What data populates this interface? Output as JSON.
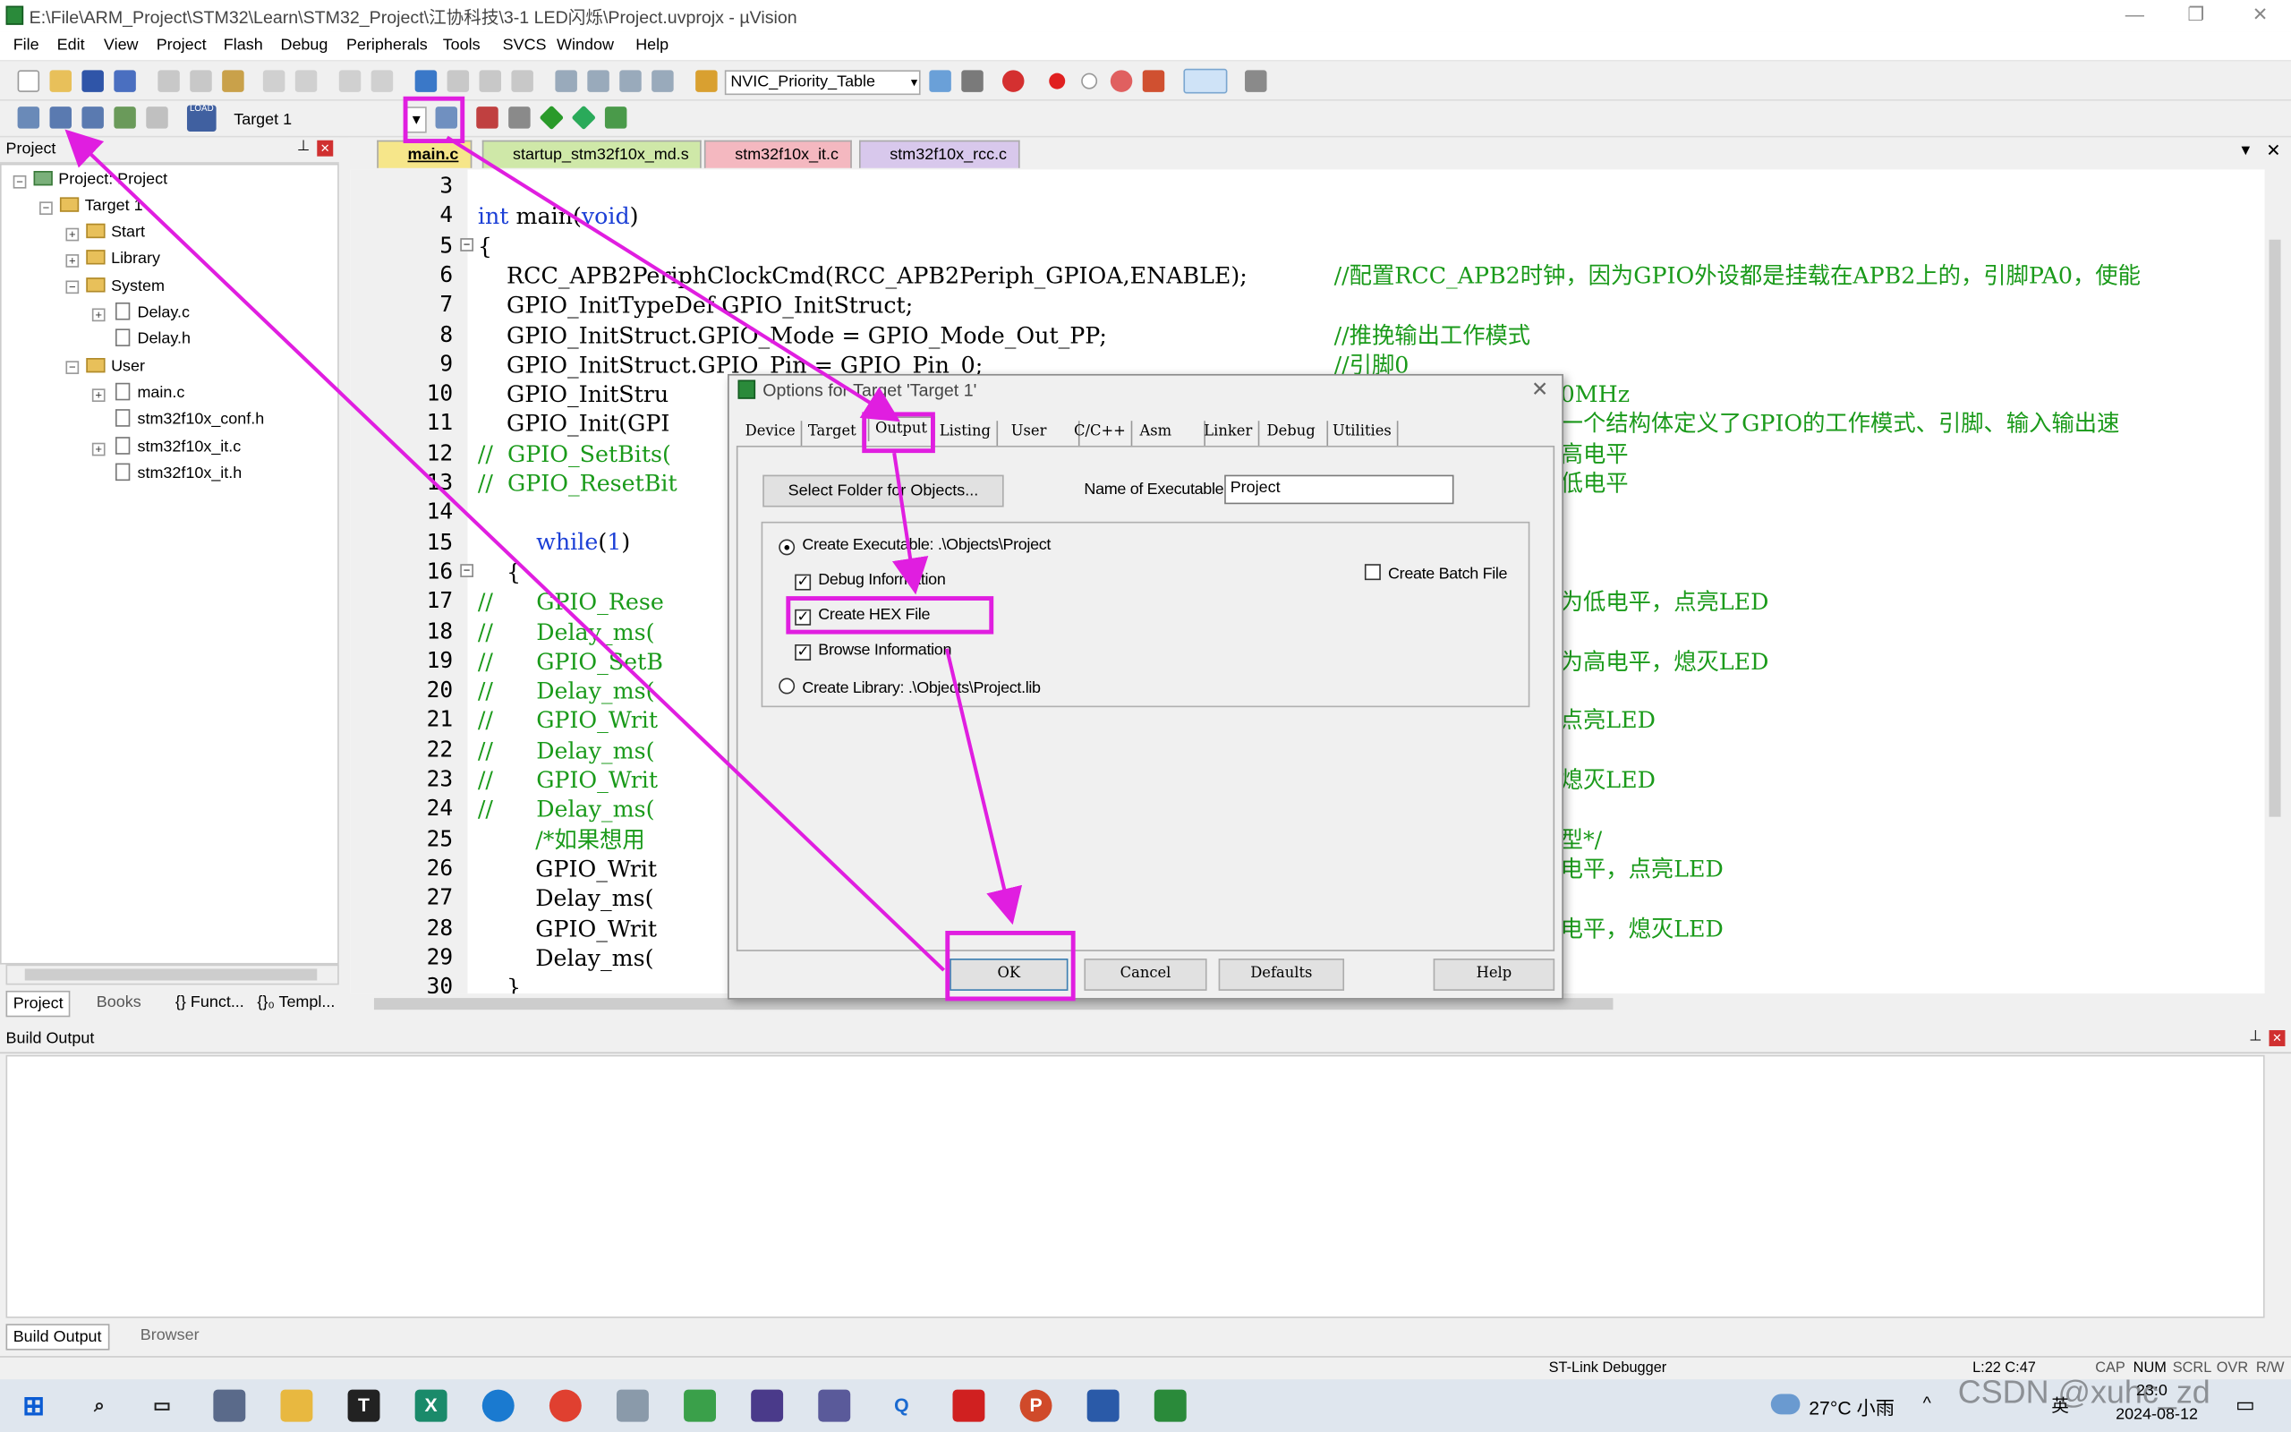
{
  "window": {
    "title": "E:\\File\\ARM_Project\\STM32\\Learn\\STM32_Project\\江协科技\\3-1 LED闪烁\\Project.uvprojx - µVision"
  },
  "menu": [
    "File",
    "Edit",
    "View",
    "Project",
    "Flash",
    "Debug",
    "Peripherals",
    "Tools",
    "SVCS",
    "Window",
    "Help"
  ],
  "toolbar": {
    "nvic_select": "NVIC_Priority_Table",
    "target_select": "Target 1",
    "load_label": "LOAD"
  },
  "project_panel": {
    "title": "Project",
    "tree": [
      {
        "label": "Project: Project"
      },
      {
        "label": "Target 1"
      },
      {
        "label": "Start"
      },
      {
        "label": "Library"
      },
      {
        "label": "System"
      },
      {
        "label": "Delay.c"
      },
      {
        "label": "Delay.h"
      },
      {
        "label": "User"
      },
      {
        "label": "main.c"
      },
      {
        "label": "stm32f10x_conf.h"
      },
      {
        "label": "stm32f10x_it.c"
      },
      {
        "label": "stm32f10x_it.h"
      }
    ],
    "bottom_tabs": [
      "Project",
      "Books",
      "{} Funct...",
      "{}₀ Templ..."
    ]
  },
  "file_tabs": [
    "main.c",
    "startup_stm32f10x_md.s",
    "stm32f10x_it.c",
    "stm32f10x_rcc.c"
  ],
  "code_lines": [
    {
      "n": "3",
      "t": ""
    },
    {
      "n": "4",
      "t": ""
    },
    {
      "n": "5",
      "t": "{"
    },
    {
      "n": "6",
      "t": "    RCC_APB2PeriphClockCmd(RCC_APB2Periph_GPIOA,ENABLE);",
      "c": "//配置RCC_APB2时钟，因为GPIO外设都是挂载在APB2上的，引脚PA0，使能"
    },
    {
      "n": "7",
      "t": "    GPIO_InitTypeDef GPIO_InitStruct;"
    },
    {
      "n": "8",
      "t": "    GPIO_InitStruct.GPIO_Mode = GPIO_Mode_Out_PP;",
      "c": "//推挽输出工作模式"
    },
    {
      "n": "9",
      "t": "    GPIO_InitStruct.GPIO_Pin = GPIO_Pin_0;",
      "c": "//引脚0"
    },
    {
      "n": "10",
      "t": "    GPIO_InitStru",
      "c2": "0MHz"
    },
    {
      "n": "11",
      "t": "    GPIO_Init(GPI",
      "c2": "一个结构体定义了GPIO的工作模式、引脚、输入输出速"
    },
    {
      "n": "12",
      "t": "",
      "c": "//  GPIO_SetBits(",
      "c2": "高电平"
    },
    {
      "n": "13",
      "t": "",
      "c": "//  GPIO_ResetBit",
      "c2": "低电平"
    },
    {
      "n": "14",
      "t": ""
    },
    {
      "n": "15",
      "t": ""
    },
    {
      "n": "16",
      "t": "    {"
    },
    {
      "n": "17",
      "t": "",
      "c": "//      GPIO_Rese",
      "c2": "为低电平，点亮LED"
    },
    {
      "n": "18",
      "t": "",
      "c": "//      Delay_ms("
    },
    {
      "n": "19",
      "t": "",
      "c": "//      GPIO_SetB",
      "c2": "为高电平，熄灭LED"
    },
    {
      "n": "20",
      "t": "",
      "c": "//      Delay_ms("
    },
    {
      "n": "21",
      "t": "",
      "c": "//      GPIO_Writ",
      "c2": "点亮LED"
    },
    {
      "n": "22",
      "t": "",
      "c": "//      Delay_ms("
    },
    {
      "n": "23",
      "t": "",
      "c": "//      GPIO_Writ",
      "c2": "熄灭LED"
    },
    {
      "n": "24",
      "t": "",
      "c": "//      Delay_ms("
    },
    {
      "n": "25",
      "t": "",
      "c": "        /*如果想用",
      "c2": "型*/"
    },
    {
      "n": "26",
      "t": "        GPIO_Writ",
      "c2": "电平，点亮LED"
    },
    {
      "n": "27",
      "t": "        Delay_ms("
    },
    {
      "n": "28",
      "t": "        GPIO_Writ",
      "c2": "电平，熄灭LED"
    },
    {
      "n": "29",
      "t": "        Delay_ms("
    },
    {
      "n": "30",
      "t": "    }"
    }
  ],
  "code_special": {
    "int_kw": "int",
    "main_fn": " main(",
    "void_kw": "void",
    "close": ")",
    "while_kw": "while",
    "while_rest": "(",
    "one": "1",
    "while_close": ")"
  },
  "dialog": {
    "title": "Options for Target 'Target 1'",
    "tabs": [
      "Device",
      "Target",
      "Output",
      "Listing",
      "User",
      "C/C++",
      "Asm",
      "Linker",
      "Debug",
      "Utilities"
    ],
    "select_folder_btn": "Select Folder for Objects...",
    "name_label": "Name of Executable:",
    "name_value": "Project",
    "create_exe": "Create Executable:  .\\Objects\\Project",
    "debug_info": "Debug Information",
    "create_hex": "Create HEX File",
    "browse_info": "Browse Information",
    "create_lib": "Create Library:  .\\Objects\\Project.lib",
    "batch_file": "Create Batch File",
    "ok": "OK",
    "cancel": "Cancel",
    "defaults": "Defaults",
    "help": "Help",
    "close_glyph": "✕"
  },
  "build_output": {
    "title": "Build Output",
    "tabs": [
      "Build Output",
      "Browser"
    ]
  },
  "statusbar": {
    "debugger": "ST-Link Debugger",
    "pos": "L:22 C:47",
    "flags": [
      "CAP",
      "NUM",
      "SCRL",
      "OVR",
      "R/W"
    ]
  },
  "taskbar": {
    "weather": "27°C 小雨",
    "ime": "英",
    "time": "23:0",
    "date": "2024-08-12",
    "watermark": "CSDN @xuhc_zd"
  },
  "colors": {
    "annotation": "#e01ee0",
    "comment": "#1a9a1a",
    "keyword": "#1b3fd6"
  }
}
